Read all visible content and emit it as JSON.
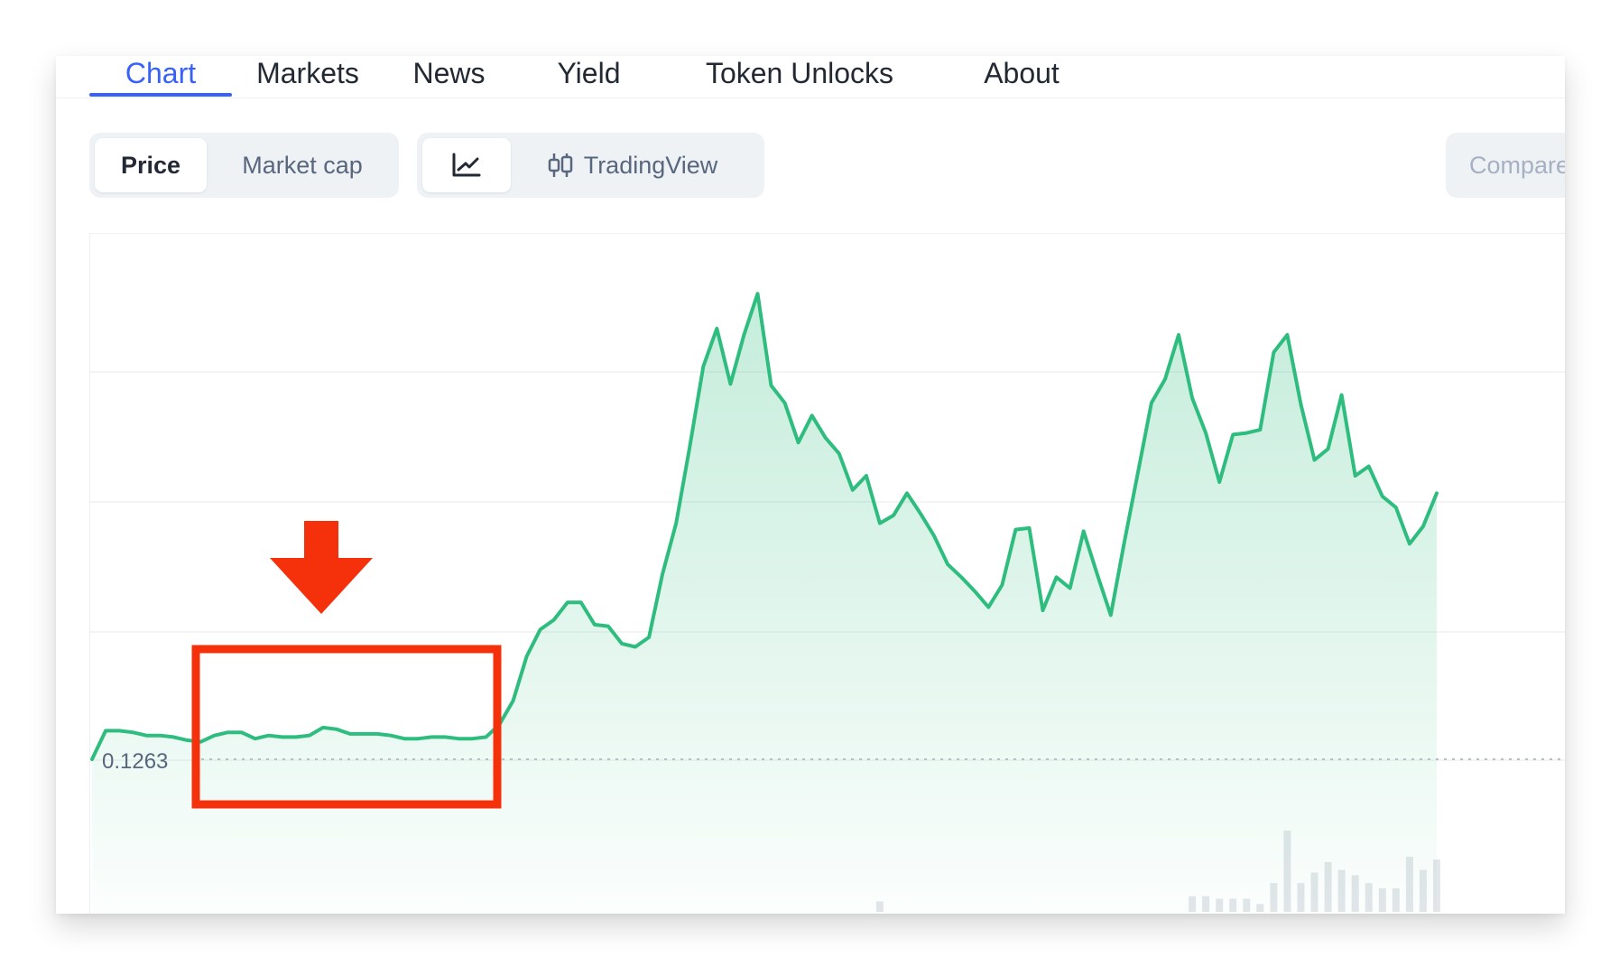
{
  "tabs": [
    {
      "label": "Chart",
      "active": true
    },
    {
      "label": "Markets"
    },
    {
      "label": "News"
    },
    {
      "label": "Yield"
    },
    {
      "label": "Token Unlocks"
    },
    {
      "label": "About"
    }
  ],
  "chart_type_toggle": {
    "price_label": "Price",
    "market_cap_label": "Market cap",
    "selected": "Price"
  },
  "view_toggle": {
    "line_icon": "line-chart-icon",
    "tradingview_icon": "candlestick-icon",
    "tradingview_label": "TradingView",
    "selected": "line"
  },
  "compare_label": "Compare",
  "colors": {
    "accent": "#3861fb",
    "line": "#2ebd7e",
    "annotation": "#f5310c",
    "volume": "#e3e6ea"
  },
  "chart_data": {
    "type": "area",
    "baseline_label": "0.1263",
    "baseline": 0.1263,
    "series": [
      {
        "values": [
          0.1263,
          0.1281,
          0.1281,
          0.128,
          0.1278,
          0.1278,
          0.1277,
          0.1275,
          0.1274,
          0.1278,
          0.128,
          0.128,
          0.1276,
          0.1278,
          0.1277,
          0.1277,
          0.1278,
          0.1283,
          0.1282,
          0.1279,
          0.1279,
          0.1279,
          0.1278,
          0.1276,
          0.1276,
          0.1277,
          0.1277,
          0.1276,
          0.1276,
          0.1277,
          0.1285,
          0.13,
          0.1328,
          0.1345,
          0.1351,
          0.1362,
          0.1362,
          0.1348,
          0.1347,
          0.1336,
          0.1334,
          0.134,
          0.138,
          0.1412,
          0.146,
          0.1511,
          0.1535,
          0.15,
          0.1531,
          0.1557,
          0.1499,
          0.1488,
          0.1463,
          0.148,
          0.1466,
          0.1456,
          0.1433,
          0.1442,
          0.1412,
          0.1417,
          0.1431,
          0.1418,
          0.1404,
          0.1386,
          0.1378,
          0.1369,
          0.1359,
          0.1373,
          0.1408,
          0.1409,
          0.1357,
          0.1378,
          0.1371,
          0.1407,
          0.138,
          0.1354,
          0.14,
          0.1444,
          0.1488,
          0.1503,
          0.1531,
          0.1491,
          0.1469,
          0.1438,
          0.1468,
          0.1469,
          0.1471,
          0.152,
          0.1531,
          0.1487,
          0.1452,
          0.1459,
          0.1493,
          0.1442,
          0.1448,
          0.1429,
          0.1422,
          0.1399,
          0.141,
          0.1431
        ]
      }
    ],
    "volume": [
      {
        "i": 58,
        "v": 0.08
      },
      {
        "i": 81,
        "v": 0.12
      },
      {
        "i": 82,
        "v": 0.12
      },
      {
        "i": 83,
        "v": 0.1
      },
      {
        "i": 84,
        "v": 0.1
      },
      {
        "i": 85,
        "v": 0.1
      },
      {
        "i": 86,
        "v": 0.06
      },
      {
        "i": 87,
        "v": 0.22
      },
      {
        "i": 88,
        "v": 0.62
      },
      {
        "i": 89,
        "v": 0.22
      },
      {
        "i": 90,
        "v": 0.3
      },
      {
        "i": 91,
        "v": 0.38
      },
      {
        "i": 92,
        "v": 0.32
      },
      {
        "i": 93,
        "v": 0.28
      },
      {
        "i": 94,
        "v": 0.22
      },
      {
        "i": 95,
        "v": 0.18
      },
      {
        "i": 96,
        "v": 0.18
      },
      {
        "i": 97,
        "v": 0.42
      },
      {
        "i": 98,
        "v": 0.32
      },
      {
        "i": 99,
        "v": 0.4
      }
    ],
    "grid": true
  }
}
